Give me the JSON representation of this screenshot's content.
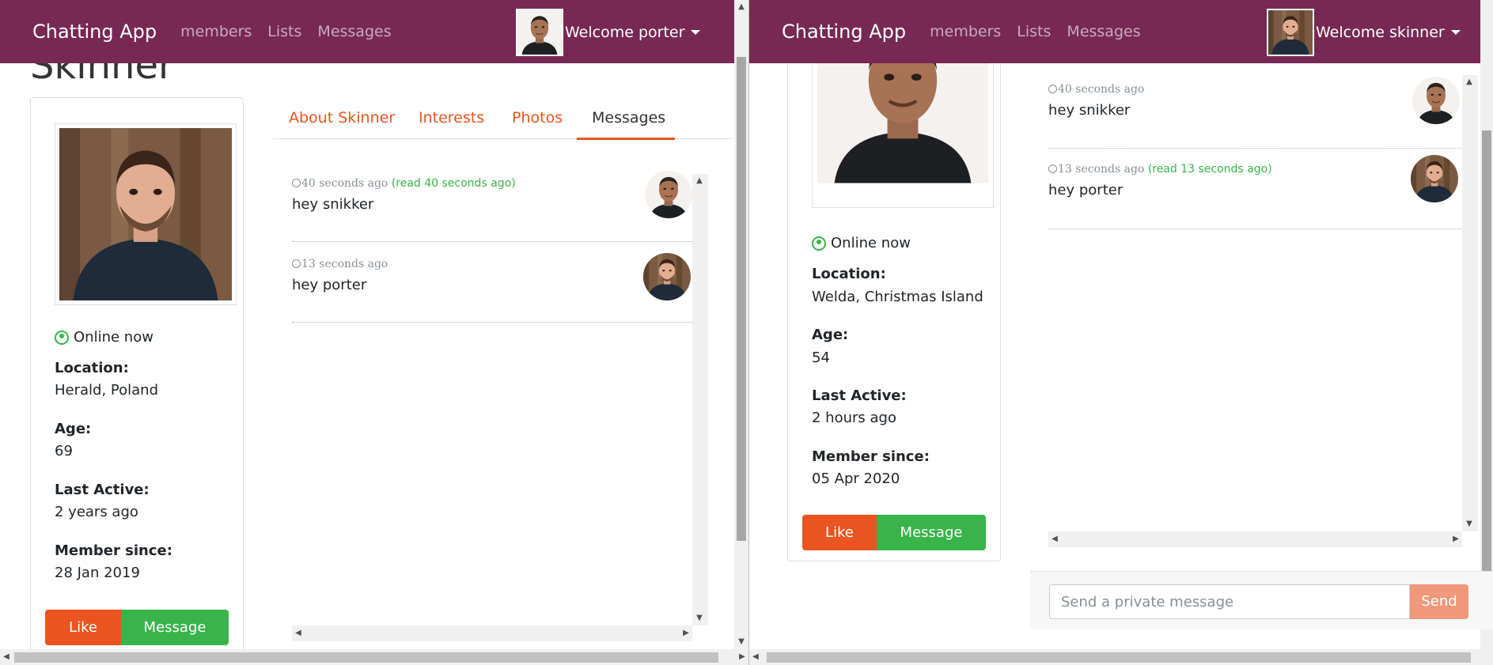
{
  "left": {
    "navbar": {
      "brand": "Chatting App",
      "links": [
        "members",
        "Lists",
        "Messages"
      ],
      "welcome": "Welcome porter"
    },
    "profile": {
      "name": "Skinner",
      "status": "Online now",
      "fields": [
        {
          "label": "Location:",
          "value": "Herald, Poland"
        },
        {
          "label": "Age:",
          "value": "69"
        },
        {
          "label": "Last Active:",
          "value": "2 years ago"
        },
        {
          "label": "Member since:",
          "value": "28 Jan 2019"
        }
      ],
      "like_label": "Like",
      "message_label": "Message"
    },
    "tabs": [
      "About Skinner",
      "Interests",
      "Photos",
      "Messages"
    ],
    "messages": [
      {
        "time": "40 seconds ago",
        "read": "(read 40 seconds ago)",
        "text": "hey snikker",
        "avatar": "porter-avatar"
      },
      {
        "time": "13 seconds ago",
        "read": "",
        "text": "hey porter",
        "avatar": "skinner-avatar"
      }
    ]
  },
  "right": {
    "navbar": {
      "brand": "Chatting App",
      "links": [
        "members",
        "Lists",
        "Messages"
      ],
      "welcome": "Welcome skinner"
    },
    "profile": {
      "status": "Online now",
      "fields": [
        {
          "label": "Location:",
          "value": "Welda, Christmas Island"
        },
        {
          "label": "Age:",
          "value": "54"
        },
        {
          "label": "Last Active:",
          "value": "2 hours ago"
        },
        {
          "label": "Member since:",
          "value": "05 Apr 2020"
        }
      ],
      "like_label": "Like",
      "message_label": "Message"
    },
    "messages": [
      {
        "time": "40 seconds ago",
        "read": "",
        "text": "hey snikker",
        "avatar": "porter-avatar"
      },
      {
        "time": "13 seconds ago",
        "read": "(read 13 seconds ago)",
        "text": "hey porter",
        "avatar": "skinner-avatar"
      }
    ],
    "composer": {
      "placeholder": "Send a private message",
      "send_label": "Send"
    }
  },
  "colors": {
    "navbar": "#772953",
    "accent": "#e95420",
    "success": "#38b44a"
  }
}
